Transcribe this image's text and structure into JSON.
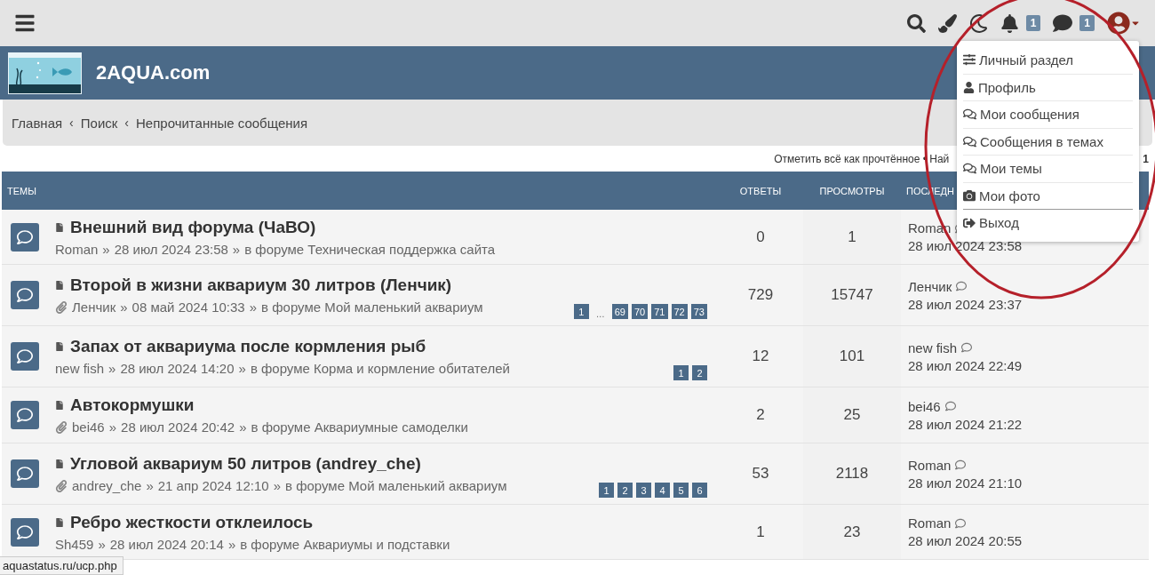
{
  "topbar": {
    "notifications_badge": "1",
    "messages_badge": "1"
  },
  "header": {
    "site_title": "2AQUA.com"
  },
  "breadcrumbs": [
    "Главная",
    "Поиск",
    "Непрочитанные сообщения"
  ],
  "breadcrumb_separator": "‹",
  "actions": {
    "mark_read": "Отметить всё как прочтённое • Най",
    "page_number": "1"
  },
  "table": {
    "meta_separator": "»",
    "columns": [
      "ТЕМЫ",
      "ОТВЕТЫ",
      "ПРОСМОТРЫ",
      "ПОСЛЕДН"
    ],
    "rows": [
      {
        "title": "Внешний вид форума (ЧаВО)",
        "attachment": false,
        "author": "Roman",
        "date": "28 июл 2024 23:58",
        "forum_prefix": "в форуме",
        "forum": "Техническая поддержка сайта",
        "pages": [],
        "replies": "0",
        "views": "1",
        "last_author": "Roman",
        "last_date": "28 июл 2024 23:58"
      },
      {
        "title": "Второй в жизни аквариум 30 литров (Ленчик)",
        "attachment": true,
        "author": "Ленчик",
        "date": "08 май 2024 10:33",
        "forum_prefix": "в форуме",
        "forum": "Мой маленький аквариум",
        "pages": [
          {
            "kind": "page",
            "label": "1"
          },
          {
            "kind": "ellipsis",
            "label": "…"
          },
          {
            "kind": "page",
            "label": "69"
          },
          {
            "kind": "page",
            "label": "70"
          },
          {
            "kind": "page",
            "label": "71"
          },
          {
            "kind": "page",
            "label": "72"
          },
          {
            "kind": "page",
            "label": "73"
          }
        ],
        "replies": "729",
        "views": "15747",
        "last_author": "Ленчик",
        "last_date": "28 июл 2024 23:37"
      },
      {
        "title": "Запах от аквариума после кормления рыб",
        "attachment": false,
        "author": "new fish",
        "date": "28 июл 2024 14:20",
        "forum_prefix": "в форуме",
        "forum": "Корма и кормление обитателей",
        "pages": [
          {
            "kind": "page",
            "label": "1"
          },
          {
            "kind": "page",
            "label": "2"
          }
        ],
        "replies": "12",
        "views": "101",
        "last_author": "new fish",
        "last_date": "28 июл 2024 22:49"
      },
      {
        "title": "Автокормушки",
        "attachment": true,
        "author": "bei46",
        "date": "28 июл 2024 20:42",
        "forum_prefix": "в форуме",
        "forum": "Аквариумные самоделки",
        "pages": [],
        "replies": "2",
        "views": "25",
        "last_author": "bei46",
        "last_date": "28 июл 2024 21:22"
      },
      {
        "title": "Угловой аквариум 50 литров (andrey_che)",
        "attachment": true,
        "author": "andrey_che",
        "date": "21 апр 2024 12:10",
        "forum_prefix": "в форуме",
        "forum": "Мой маленький аквариум",
        "pages": [
          {
            "kind": "page",
            "label": "1"
          },
          {
            "kind": "page",
            "label": "2"
          },
          {
            "kind": "page",
            "label": "3"
          },
          {
            "kind": "page",
            "label": "4"
          },
          {
            "kind": "page",
            "label": "5"
          },
          {
            "kind": "page",
            "label": "6"
          }
        ],
        "replies": "53",
        "views": "2118",
        "last_author": "Roman",
        "last_date": "28 июл 2024 21:10"
      },
      {
        "title": "Ребро жесткости отклеилось",
        "attachment": false,
        "author": "Sh459",
        "date": "28 июл 2024 20:14",
        "forum_prefix": "в форуме",
        "forum": "Аквариумы и подставки",
        "pages": [],
        "replies": "1",
        "views": "23",
        "last_author": "Roman",
        "last_date": "28 июл 2024 20:55"
      }
    ]
  },
  "user_menu": {
    "items": [
      {
        "kind": "sliders",
        "label": "Личный раздел"
      },
      {
        "kind": "user",
        "label": "Профиль"
      },
      {
        "kind": "comments",
        "label": "Мои сообщения"
      },
      {
        "kind": "comments",
        "label": "Сообщения в темах"
      },
      {
        "kind": "comments",
        "label": "Мои темы"
      },
      {
        "kind": "camera",
        "label": "Мои фото"
      },
      {
        "kind": "logout",
        "label": "Выход"
      }
    ]
  },
  "status_url": "aquastatus.ru/ucp.php"
}
